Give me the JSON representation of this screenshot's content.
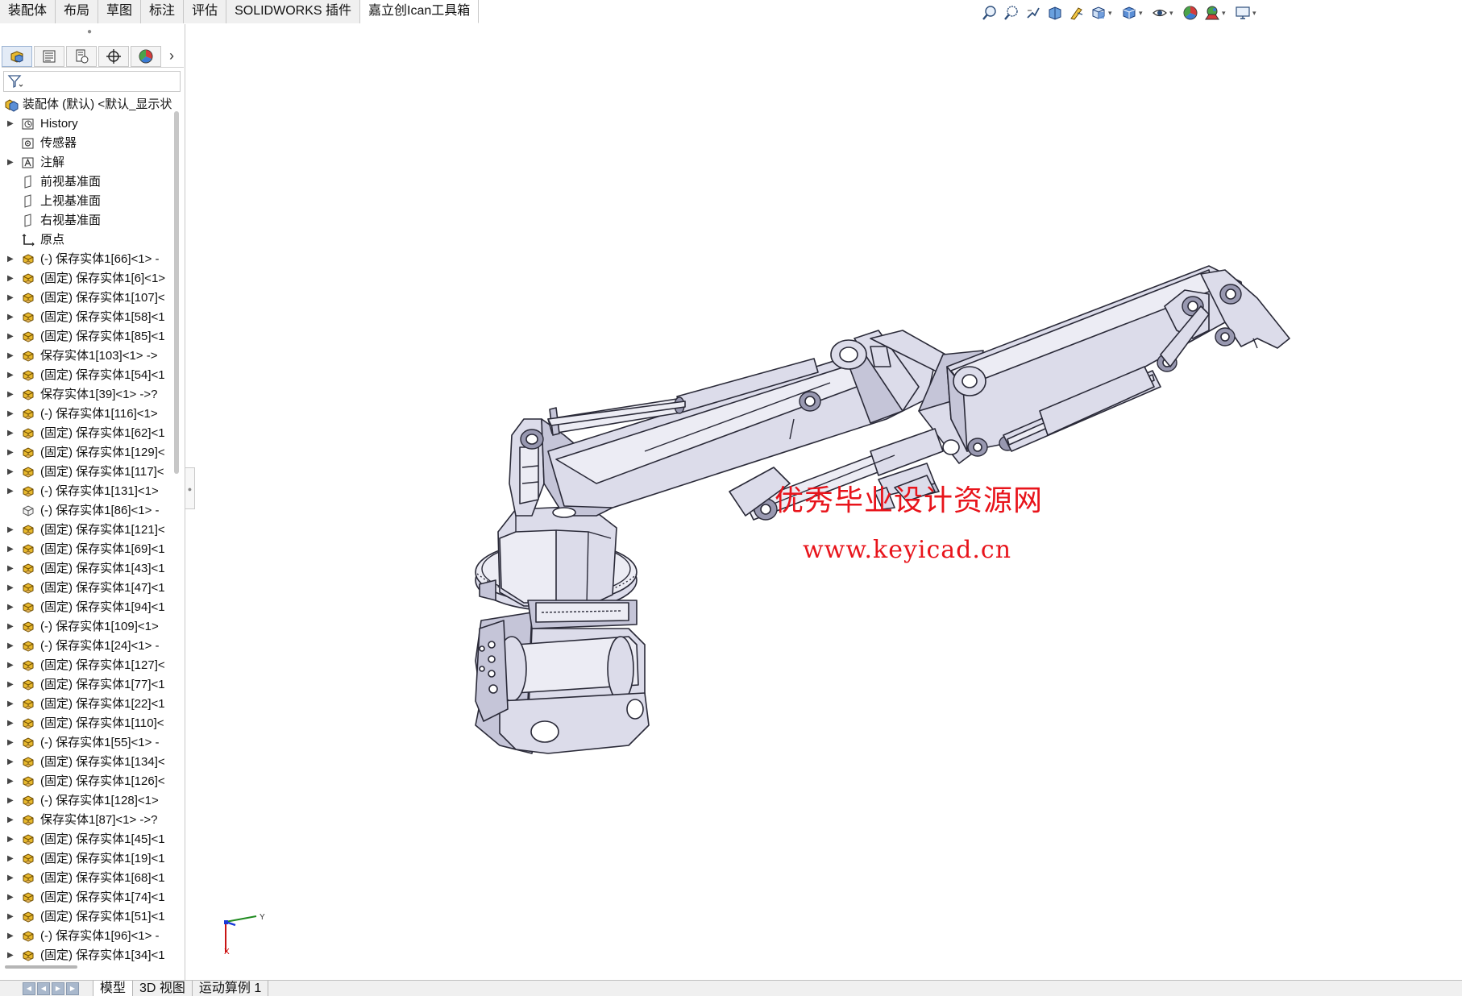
{
  "command_tabs": [
    {
      "label": "装配体",
      "active": false
    },
    {
      "label": "布局",
      "active": false
    },
    {
      "label": "草图",
      "active": false
    },
    {
      "label": "标注",
      "active": false
    },
    {
      "label": "评估",
      "active": false
    },
    {
      "label": "SOLIDWORKS 插件",
      "active": false
    },
    {
      "label": "嘉立创Ican工具箱",
      "active": true
    }
  ],
  "hud_icons": [
    "zoom-to-fit-icon",
    "zoom-area-icon",
    "previous-view-icon",
    "section-view-icon",
    "dynamic-annotation-icon",
    "view-orientation-icon",
    "display-style-icon",
    "hide-show-icon",
    "edit-appearance-icon",
    "apply-scene-icon",
    "view-settings-icon"
  ],
  "panel_tabs": [
    "featuremanager-icon",
    "propertymanager-icon",
    "configurationmanager-icon",
    "dimxpert-icon",
    "display-manager-icon"
  ],
  "tree": {
    "root_label": "装配体 (默认) <默认_显示状",
    "items": [
      {
        "label": "History",
        "icon": "history-icon",
        "expandable": true
      },
      {
        "label": "传感器",
        "icon": "sensor-icon",
        "expandable": false
      },
      {
        "label": "注解",
        "icon": "annotation-icon",
        "expandable": true
      },
      {
        "label": "前视基准面",
        "icon": "plane-icon",
        "expandable": false
      },
      {
        "label": "上视基准面",
        "icon": "plane-icon",
        "expandable": false
      },
      {
        "label": "右视基准面",
        "icon": "plane-icon",
        "expandable": false
      },
      {
        "label": "原点",
        "icon": "origin-icon",
        "expandable": false
      },
      {
        "label": "(-) 保存实体1[66]<1> -",
        "icon": "part-icon",
        "expandable": true
      },
      {
        "label": "(固定) 保存实体1[6]<1>",
        "icon": "part-icon",
        "expandable": true
      },
      {
        "label": "(固定) 保存实体1[107]<",
        "icon": "part-icon",
        "expandable": true
      },
      {
        "label": "(固定) 保存实体1[58]<1",
        "icon": "part-icon",
        "expandable": true
      },
      {
        "label": "(固定) 保存实体1[85]<1",
        "icon": "part-icon",
        "expandable": true
      },
      {
        "label": "保存实体1[103]<1> ->",
        "icon": "part-icon",
        "expandable": true
      },
      {
        "label": "(固定) 保存实体1[54]<1",
        "icon": "part-icon",
        "expandable": true
      },
      {
        "label": "保存实体1[39]<1> ->?",
        "icon": "part-icon",
        "expandable": true
      },
      {
        "label": "(-) 保存实体1[116]<1>",
        "icon": "part-icon",
        "expandable": true
      },
      {
        "label": "(固定) 保存实体1[62]<1",
        "icon": "part-icon",
        "expandable": true
      },
      {
        "label": "(固定) 保存实体1[129]<",
        "icon": "part-icon",
        "expandable": true
      },
      {
        "label": "(固定) 保存实体1[117]<",
        "icon": "part-icon",
        "expandable": true
      },
      {
        "label": "(-) 保存实体1[131]<1>",
        "icon": "part-icon",
        "expandable": true
      },
      {
        "label": "(-) 保存实体1[86]<1> -",
        "icon": "part-outline-icon",
        "expandable": false
      },
      {
        "label": "(固定) 保存实体1[121]<",
        "icon": "part-icon",
        "expandable": true
      },
      {
        "label": "(固定) 保存实体1[69]<1",
        "icon": "part-icon",
        "expandable": true
      },
      {
        "label": "(固定) 保存实体1[43]<1",
        "icon": "part-icon",
        "expandable": true
      },
      {
        "label": "(固定) 保存实体1[47]<1",
        "icon": "part-icon",
        "expandable": true
      },
      {
        "label": "(固定) 保存实体1[94]<1",
        "icon": "part-icon",
        "expandable": true
      },
      {
        "label": "(-) 保存实体1[109]<1>",
        "icon": "part-icon",
        "expandable": true
      },
      {
        "label": "(-) 保存实体1[24]<1> -",
        "icon": "part-icon",
        "expandable": true
      },
      {
        "label": "(固定) 保存实体1[127]<",
        "icon": "part-icon",
        "expandable": true
      },
      {
        "label": "(固定) 保存实体1[77]<1",
        "icon": "part-icon",
        "expandable": true
      },
      {
        "label": "(固定) 保存实体1[22]<1",
        "icon": "part-icon",
        "expandable": true
      },
      {
        "label": "(固定) 保存实体1[110]<",
        "icon": "part-icon",
        "expandable": true
      },
      {
        "label": "(-) 保存实体1[55]<1> -",
        "icon": "part-icon",
        "expandable": true
      },
      {
        "label": "(固定) 保存实体1[134]<",
        "icon": "part-icon",
        "expandable": true
      },
      {
        "label": "(固定) 保存实体1[126]<",
        "icon": "part-icon",
        "expandable": true
      },
      {
        "label": "(-) 保存实体1[128]<1>",
        "icon": "part-icon",
        "expandable": true
      },
      {
        "label": "保存实体1[87]<1> ->?",
        "icon": "part-icon",
        "expandable": true
      },
      {
        "label": "(固定) 保存实体1[45]<1",
        "icon": "part-icon",
        "expandable": true
      },
      {
        "label": "(固定) 保存实体1[19]<1",
        "icon": "part-icon",
        "expandable": true
      },
      {
        "label": "(固定) 保存实体1[68]<1",
        "icon": "part-icon",
        "expandable": true
      },
      {
        "label": "(固定) 保存实体1[74]<1",
        "icon": "part-icon",
        "expandable": true
      },
      {
        "label": "(固定) 保存实体1[51]<1",
        "icon": "part-icon",
        "expandable": true
      },
      {
        "label": "(-) 保存实体1[96]<1> -",
        "icon": "part-icon",
        "expandable": true
      },
      {
        "label": "(固定) 保存实体1[34]<1",
        "icon": "part-icon",
        "expandable": true
      }
    ]
  },
  "viewport": {
    "watermark_cn": "优秀毕业设计资源网",
    "watermark_url": "www.keyicad.cn",
    "triad_y": "Y",
    "triad_x": "X"
  },
  "bottom_tabs": [
    {
      "label": "模型",
      "active": true
    },
    {
      "label": "3D 视图",
      "active": false
    },
    {
      "label": "运动算例 1",
      "active": false
    }
  ],
  "colors": {
    "part_yellow": "#e8b92e",
    "model_fill": "#dcdcea",
    "model_stroke": "#2a2a38",
    "watermark": "#e8141b",
    "selection": "#e3ebf6"
  }
}
